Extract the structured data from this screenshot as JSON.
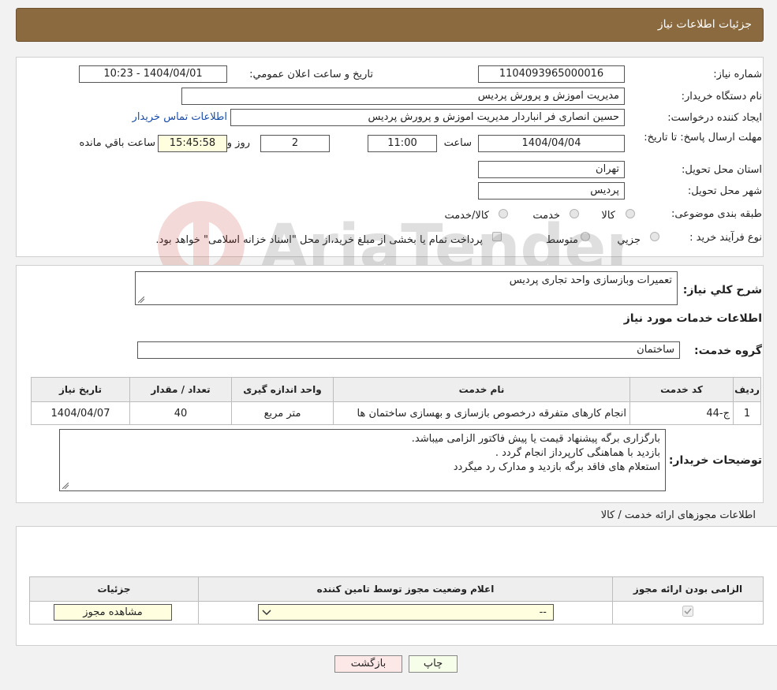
{
  "header": {
    "title": "جزئیات اطلاعات نیاز"
  },
  "form": {
    "need_number_label": "شماره نیاز:",
    "need_number": "1104093965000016",
    "announce_label": "تاریخ و ساعت اعلان عمومي:",
    "announce_value": "1404/04/01 - 10:23",
    "buyer_org_label": "نام دستگاه خریدار:",
    "buyer_org": "مدیریت اموزش و پرورش پردیس",
    "creator_label": "ایجاد کننده درخواست:",
    "creator": "حسین انصاری فر انباردار مدیریت اموزش و پرورش پردیس",
    "contact_link": "اطلاعات تماس خریدار",
    "deadline_label": "مهلت ارسال پاسخ: تا تاریخ:",
    "deadline_date": "1404/04/04",
    "time_label": "ساعت",
    "deadline_time": "11:00",
    "days_value": "2",
    "days_label": "روز و",
    "remaining_time": "15:45:58",
    "remaining_label": "ساعت باقي مانده",
    "province_label": "استان محل تحویل:",
    "province": "تهران",
    "city_label": "شهر محل تحویل:",
    "city": "پردیس",
    "category_label": "طبقه بندی موضوعی:",
    "category_options": [
      "کالا",
      "خدمت",
      "کالا/خدمت"
    ],
    "process_label": "نوع فرآیند خرید :",
    "process_options": [
      "جزیي",
      "متوسط"
    ],
    "payment_note": "پرداخت تمام یا بخشی از مبلغ خرید،از محل \"اسناد خزانه اسلامی\" خواهد بود."
  },
  "details": {
    "summary_label": "شرح کلي نیاز:",
    "summary": "تعمیرات وبازسازی واحد تجاری پردیس",
    "services_title": "اطلاعات خدمات مورد نیاز",
    "service_group_label": "گروه خدمت:",
    "service_group": "ساختمان",
    "table": {
      "headers": [
        "ردیف",
        "کد خدمت",
        "نام خدمت",
        "واحد اندازه گیری",
        "تعداد / مقدار",
        "تاریخ نیاز"
      ],
      "rows": [
        [
          "1",
          "ج-44",
          "انجام کارهای متفرقه درخصوص بازسازی و بهسازی ساختمان ها",
          "متر مربع",
          "40",
          "1404/04/07"
        ]
      ]
    },
    "buyer_notes_label": "توضیحات خریدار:",
    "buyer_notes": [
      "بارگزاری برگه پیشنهاد قیمت یا پیش فاکتور الزامی میباشد.",
      "بازدید با هماهنگی کارپرداز انجام گردد .",
      " استعلام های فاقد برگه بازدید و مدارک رد میگردد"
    ]
  },
  "permits": {
    "title": "اطلاعات مجوزهای ارائه خدمت / کالا",
    "headers": [
      "الزامی بودن ارائه مجوز",
      "اعلام وضعیت مجوز توسط تامین کننده",
      "جزئیات"
    ],
    "select_value": "--",
    "view_button": "مشاهده مجوز"
  },
  "buttons": {
    "print": "چاپ",
    "back": "بازگشت"
  },
  "watermark": {
    "text": "AriaTender.neT"
  }
}
